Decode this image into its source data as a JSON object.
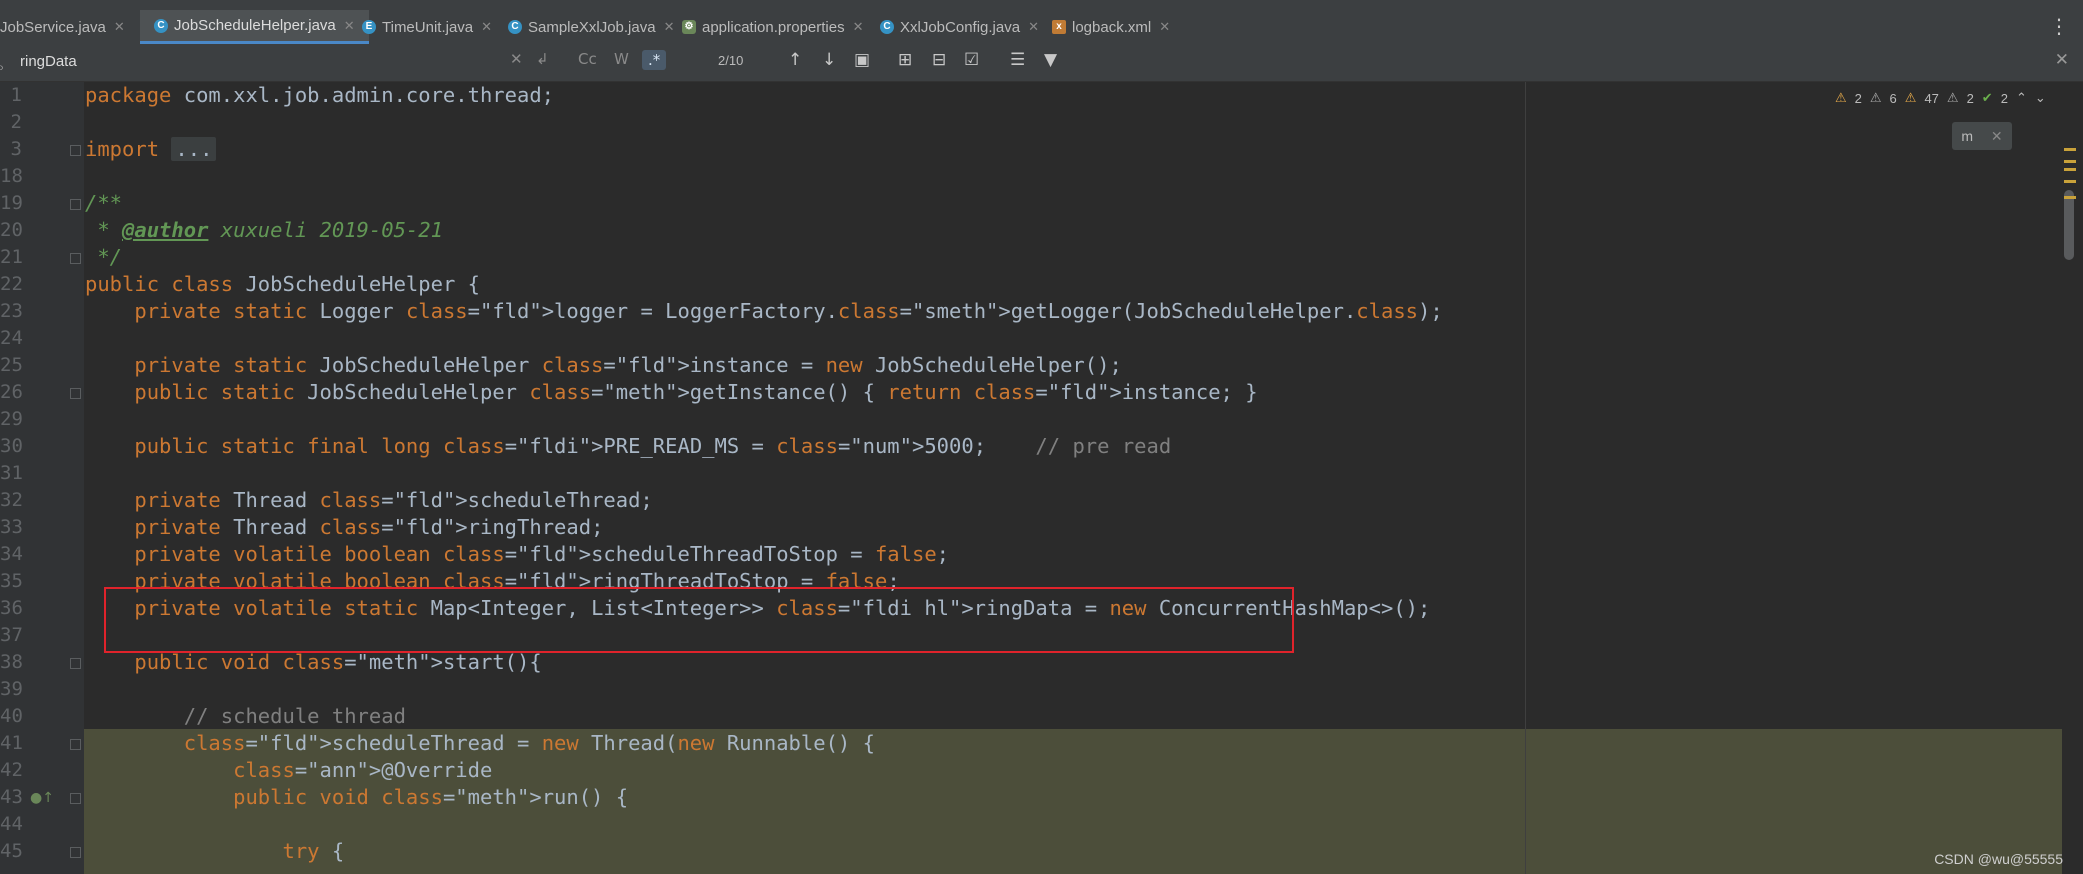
{
  "tabs": [
    {
      "label": "JobService.java",
      "icon": "class-icon",
      "active": false
    },
    {
      "label": "JobScheduleHelper.java",
      "icon": "class-icon",
      "active": true
    },
    {
      "label": "TimeUnit.java",
      "icon": "enum-icon",
      "active": false
    },
    {
      "label": "SampleXxlJob.java",
      "icon": "class-icon",
      "active": false
    },
    {
      "label": "application.properties",
      "icon": "spring-leaf-icon",
      "active": false
    },
    {
      "label": "XxlJobConfig.java",
      "icon": "class-icon",
      "active": false
    },
    {
      "label": "logback.xml",
      "icon": "xml-icon",
      "active": false
    }
  ],
  "search": {
    "query": "ringData",
    "match_count": "2/10",
    "options": [
      "Cc",
      "W",
      ".*"
    ]
  },
  "inspections": {
    "warnings": "2",
    "weak_warnings": "6",
    "typos": "47",
    "other": "2",
    "ok": "2"
  },
  "lines": [
    {
      "n": "1",
      "text": "package com.xxl.job.admin.core.thread;"
    },
    {
      "n": "2",
      "text": ""
    },
    {
      "n": "3",
      "text": "import ..."
    },
    {
      "n": "18",
      "text": ""
    },
    {
      "n": "19",
      "text": "/**"
    },
    {
      "n": "20",
      "text": " * @author xuxueli 2019-05-21"
    },
    {
      "n": "21",
      "text": " */"
    },
    {
      "n": "22",
      "text": "public class JobScheduleHelper {"
    },
    {
      "n": "23",
      "text": "    private static Logger logger = LoggerFactory.getLogger(JobScheduleHelper.class);"
    },
    {
      "n": "24",
      "text": ""
    },
    {
      "n": "25",
      "text": "    private static JobScheduleHelper instance = new JobScheduleHelper();"
    },
    {
      "n": "26",
      "text": "    public static JobScheduleHelper getInstance() { return instance; }"
    },
    {
      "n": "29",
      "text": ""
    },
    {
      "n": "30",
      "text": "    public static final long PRE_READ_MS = 5000;    // pre read"
    },
    {
      "n": "31",
      "text": ""
    },
    {
      "n": "32",
      "text": "    private Thread scheduleThread;"
    },
    {
      "n": "33",
      "text": "    private Thread ringThread;"
    },
    {
      "n": "34",
      "text": "    private volatile boolean scheduleThreadToStop = false;"
    },
    {
      "n": "35",
      "text": "    private volatile boolean ringThreadToStop = false;"
    },
    {
      "n": "36",
      "text": "    private volatile static Map<Integer, List<Integer>> ringData = new ConcurrentHashMap<>();"
    },
    {
      "n": "37",
      "text": ""
    },
    {
      "n": "38",
      "text": "    public void start(){"
    },
    {
      "n": "39",
      "text": ""
    },
    {
      "n": "40",
      "text": "        // schedule thread"
    },
    {
      "n": "41",
      "text": "        scheduleThread = new Thread(new Runnable() {"
    },
    {
      "n": "42",
      "text": "            @Override"
    },
    {
      "n": "43",
      "text": "            public void run() {"
    },
    {
      "n": "44",
      "text": ""
    },
    {
      "n": "45",
      "text": "                try {"
    }
  ],
  "watermark": "CSDN @wu@55555",
  "colors": {
    "editor_bg": "#2b2b2b",
    "keyword": "#cc7832",
    "field": "#9876aa",
    "number": "#6897bb",
    "comment": "#808080",
    "doc": "#629755",
    "method": "#ffc66d",
    "highlight_box": "#e0232b"
  }
}
